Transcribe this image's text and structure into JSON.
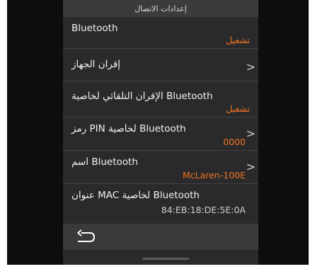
{
  "header": {
    "title": "إعدادات الاتصال"
  },
  "rows": [
    {
      "label": "Bluetooth",
      "value": "تشغيل"
    },
    {
      "label": "إقران الجهاز",
      "chevron": ">"
    },
    {
      "label": "الإقران التلقائي لخاصية Bluetooth",
      "value": "تشغيل"
    },
    {
      "label": "رمز PIN لخاصية Bluetooth",
      "value": "0000",
      "chevron": ">"
    },
    {
      "label": "اسم Bluetooth",
      "value": "McLaren-100E",
      "chevron": ">"
    },
    {
      "label": "عنوان MAC لخاصية Bluetooth",
      "value": "84:EB:18:DE:5E:0A"
    }
  ],
  "footer": {
    "back_icon": "back-arrow-icon"
  },
  "colors": {
    "accent": "#f0741f",
    "panel": "#2a2a2c",
    "title_bar": "#3b3b3d"
  }
}
